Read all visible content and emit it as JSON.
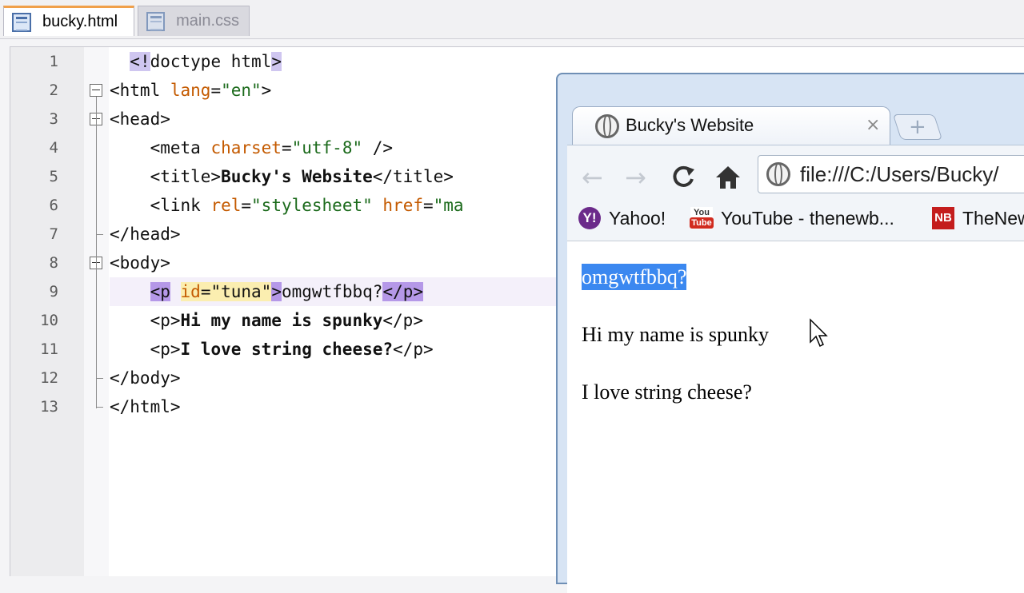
{
  "editor": {
    "tabs": [
      {
        "label": "bucky.html",
        "active": true,
        "icon": "file-icon"
      },
      {
        "label": "main.css",
        "active": false,
        "icon": "file-icon"
      }
    ],
    "lines": [
      {
        "num": "1",
        "segs": [
          [
            "t",
            "  "
          ],
          [
            "sel",
            "<!"
          ],
          [
            "t",
            "doctype html"
          ],
          [
            "sel",
            ">"
          ]
        ]
      },
      {
        "num": "2",
        "segs": [
          [
            "t",
            "<html "
          ],
          [
            "at",
            "lang"
          ],
          [
            "t",
            "="
          ],
          [
            "sv",
            "\"en\""
          ],
          [
            "t",
            ">"
          ]
        ]
      },
      {
        "num": "3",
        "segs": [
          [
            "t",
            "<head>"
          ]
        ]
      },
      {
        "num": "4",
        "segs": [
          [
            "t",
            "    <meta "
          ],
          [
            "at",
            "charset"
          ],
          [
            "t",
            "="
          ],
          [
            "sv",
            "\"utf-8\""
          ],
          [
            "t",
            " />"
          ]
        ]
      },
      {
        "num": "5",
        "segs": [
          [
            "t",
            "    <title>"
          ],
          [
            "bd",
            "Bucky's Website"
          ],
          [
            "t",
            "</title>"
          ]
        ]
      },
      {
        "num": "6",
        "segs": [
          [
            "t",
            "    <link "
          ],
          [
            "at",
            "rel"
          ],
          [
            "t",
            "="
          ],
          [
            "sv",
            "\"stylesheet\""
          ],
          [
            "t",
            " "
          ],
          [
            "at",
            "href"
          ],
          [
            "t",
            "="
          ],
          [
            "sv",
            "\"ma"
          ]
        ]
      },
      {
        "num": "7",
        "segs": [
          [
            "t",
            "</head>"
          ]
        ]
      },
      {
        "num": "8",
        "segs": [
          [
            "t",
            "<body>"
          ]
        ]
      },
      {
        "num": "9",
        "segs": [
          [
            "t",
            "    "
          ],
          [
            "mt1",
            "<p"
          ],
          [
            "t",
            " "
          ],
          [
            "mt2a",
            "id"
          ],
          [
            "mt2",
            "=\"tuna\""
          ],
          [
            "mt1",
            ">"
          ],
          [
            "t",
            "omgwtfbbq?"
          ],
          [
            "mt1",
            "</p>"
          ]
        ]
      },
      {
        "num": "10",
        "segs": [
          [
            "t",
            "    <p>"
          ],
          [
            "bd",
            "Hi my name is spunky"
          ],
          [
            "t",
            "</p>"
          ]
        ]
      },
      {
        "num": "11",
        "segs": [
          [
            "t",
            "    <p>"
          ],
          [
            "bd",
            "I love string cheese?"
          ],
          [
            "t",
            "</p>"
          ]
        ]
      },
      {
        "num": "12",
        "segs": [
          [
            "t",
            "</body>"
          ]
        ]
      },
      {
        "num": "13",
        "segs": [
          [
            "t",
            "</html>"
          ]
        ]
      }
    ]
  },
  "browser": {
    "tab_title": "Bucky's Website",
    "close_glyph": "×",
    "newtab_glyph": "+",
    "back_glyph": "←",
    "forward_glyph": "→",
    "reload_glyph": "C",
    "home_glyph": "⌂",
    "url": "file:///C:/Users/Bucky/",
    "bookmarks": [
      {
        "label": "Yahoo!",
        "icon_text": "Y!"
      },
      {
        "label": "YouTube - thenewb...",
        "icon_text": "You",
        "icon_text2": "Tube"
      },
      {
        "label": "TheNew",
        "icon_text": "NB"
      }
    ],
    "paragraphs": [
      {
        "text": "omgwtfbbq?",
        "selected": true
      },
      {
        "text": "Hi my name is spunky",
        "selected": false
      },
      {
        "text": "I love string cheese?",
        "selected": false
      }
    ]
  }
}
